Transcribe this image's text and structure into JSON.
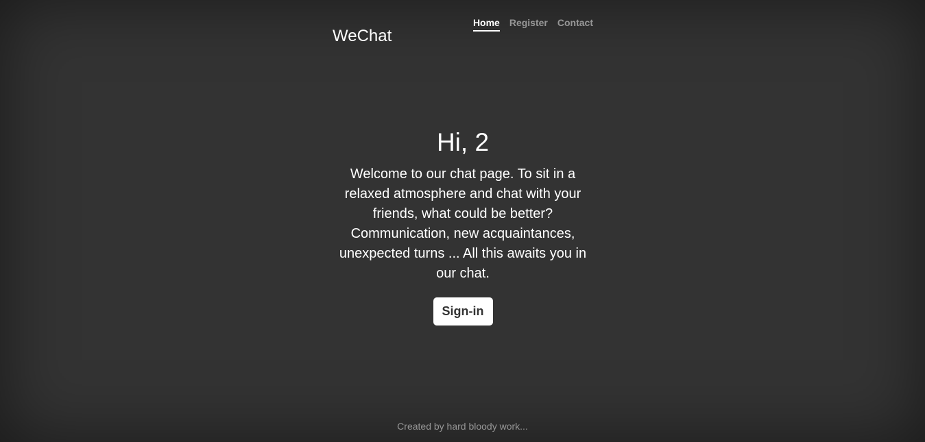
{
  "header": {
    "brand": "WeChat",
    "nav": [
      {
        "label": "Home",
        "active": true
      },
      {
        "label": "Register",
        "active": false
      },
      {
        "label": "Contact",
        "active": false
      }
    ]
  },
  "main": {
    "heading": "Hi, 2",
    "lead": "Welcome to our chat page. To sit in a relaxed atmosphere and chat with your friends, what could be better? Communication, new acquaintances, unexpected turns ... All this awaits you in our chat.",
    "signin_label": "Sign-in"
  },
  "footer": {
    "text": "Created by hard bloody work..."
  },
  "colors": {
    "background": "#333333",
    "text": "#ffffff",
    "muted": "#999999",
    "button_bg": "#ffffff",
    "button_text": "#333333"
  }
}
